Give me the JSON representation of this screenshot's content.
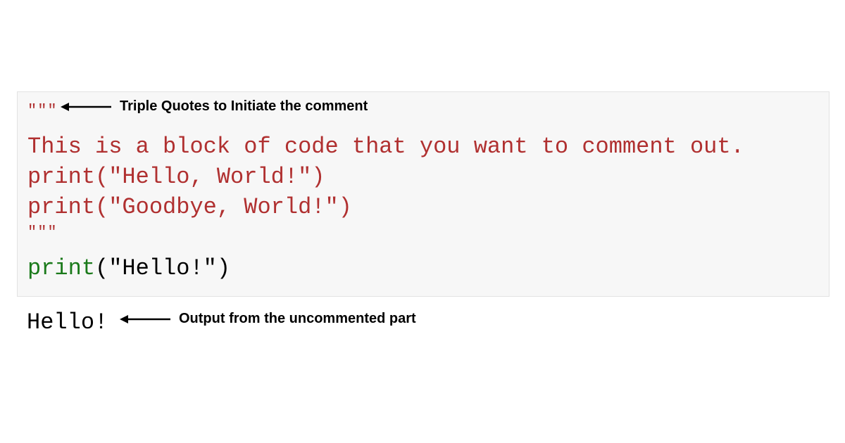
{
  "code": {
    "open_quotes": "\"\"\"",
    "line1": "This is a block of code that you want to comment out.",
    "line2": "print(\"Hello, World!\")",
    "line3": "print(\"Goodbye, World!\")",
    "close_quotes": "\"\"\"",
    "active_print": "print",
    "active_arg": "(\"Hello!\")"
  },
  "output": "Hello!",
  "annotations": {
    "top": "Triple Quotes to Initiate the comment",
    "bottom": "Output from the uncommented part"
  }
}
